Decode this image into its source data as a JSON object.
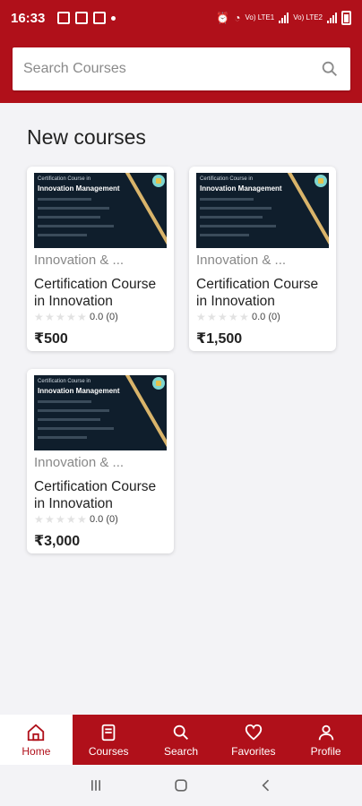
{
  "status_bar": {
    "time": "16:33",
    "net_label_1": "Vo) LTE1",
    "net_label_2": "Vo) LTE2"
  },
  "search": {
    "placeholder": "Search Courses"
  },
  "section_title": "New courses",
  "thumbnail": {
    "line1": "Certification Course in",
    "line2": "Innovation Management"
  },
  "courses": [
    {
      "category": "Innovation & ...",
      "title": "Certification Course in Innovation",
      "rating_text": "0.0 (0)",
      "price": "₹500"
    },
    {
      "category": "Innovation & ...",
      "title": "Certification Course in Innovation",
      "rating_text": "0.0 (0)",
      "price": "₹1,500"
    },
    {
      "category": "Innovation & ...",
      "title": "Certification Course in Innovation",
      "rating_text": "0.0 (0)",
      "price": "₹3,000"
    }
  ],
  "bottom_nav": {
    "items": [
      {
        "label": "Home",
        "icon": "home-icon"
      },
      {
        "label": "Courses",
        "icon": "book-icon"
      },
      {
        "label": "Search",
        "icon": "search-icon"
      },
      {
        "label": "Favorites",
        "icon": "heart-icon"
      },
      {
        "label": "Profile",
        "icon": "person-icon"
      }
    ]
  },
  "colors": {
    "brand": "#b0101a",
    "background": "#f3f3f6"
  }
}
